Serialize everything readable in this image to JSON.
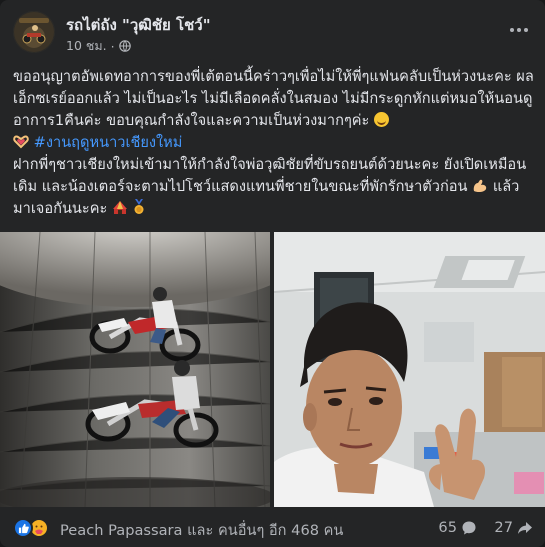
{
  "post": {
    "page_name": "รถไต่ถัง \"วุฒิชัย โชว์\"",
    "time": "10 ชม.",
    "dot": "·",
    "privacy_icon": "globe-icon",
    "avatar_text": "Vuthichai Show",
    "paragraph1": "ขออนุญาตอัพเดทอาการของพี่เต้ตอนนี้คร่าวๆเพื่อไม่ให้พี่ๆแฟนคลับเป็นห่วงนะคะ ผลเอ็กซเรย์ออกแล้ว ไม่เป็นอะไร ไม่มีเลือดคลั่งในสมอง ไม่มีกระดูกหักแต่หมอให้นอนดูอาการ1คืนค่ะ ขอบคุณกำลังใจและความเป็นห่วงมากๆค่ะ",
    "hashtag": "#งานฤดูหนาวเชียงใหม่",
    "paragraph2": "ฝากพี่ๆชาวเชียงใหม่เข้ามาให้กำลังใจพ่อวุฒิชัยที่ขับรถยนต์ด้วยนะคะ ยังเปิดเหมือนเดิม และน้องเตอร์จะตามไปโชว์แสดงแทนพี่ชายในขณะที่พักรักษาตัวก่อน",
    "paragraph2_tail": "แล้วมาเจอกันนะคะ"
  },
  "icons": {
    "more": "more-options-icon",
    "heart_hands": "heart-hands-emoji",
    "smile": "smiling-face-hearts-emoji",
    "muscle": "flexed-biceps-emoji",
    "circus": "circus-tent-emoji",
    "medal": "medal-emoji",
    "like": "like-reaction-icon",
    "care": "care-reaction-icon",
    "comment": "comment-icon",
    "share": "share-icon"
  },
  "footer": {
    "reactors": "Peach Papassara และ คนอื่นๆ อีก 468 คน",
    "comments": "65",
    "shares": "27"
  },
  "colors": {
    "card_bg": "#242526",
    "text": "#e4e6eb",
    "muted": "#b0b3b8",
    "hashtag": "#4599ff",
    "like_blue": "#1b74e4"
  }
}
